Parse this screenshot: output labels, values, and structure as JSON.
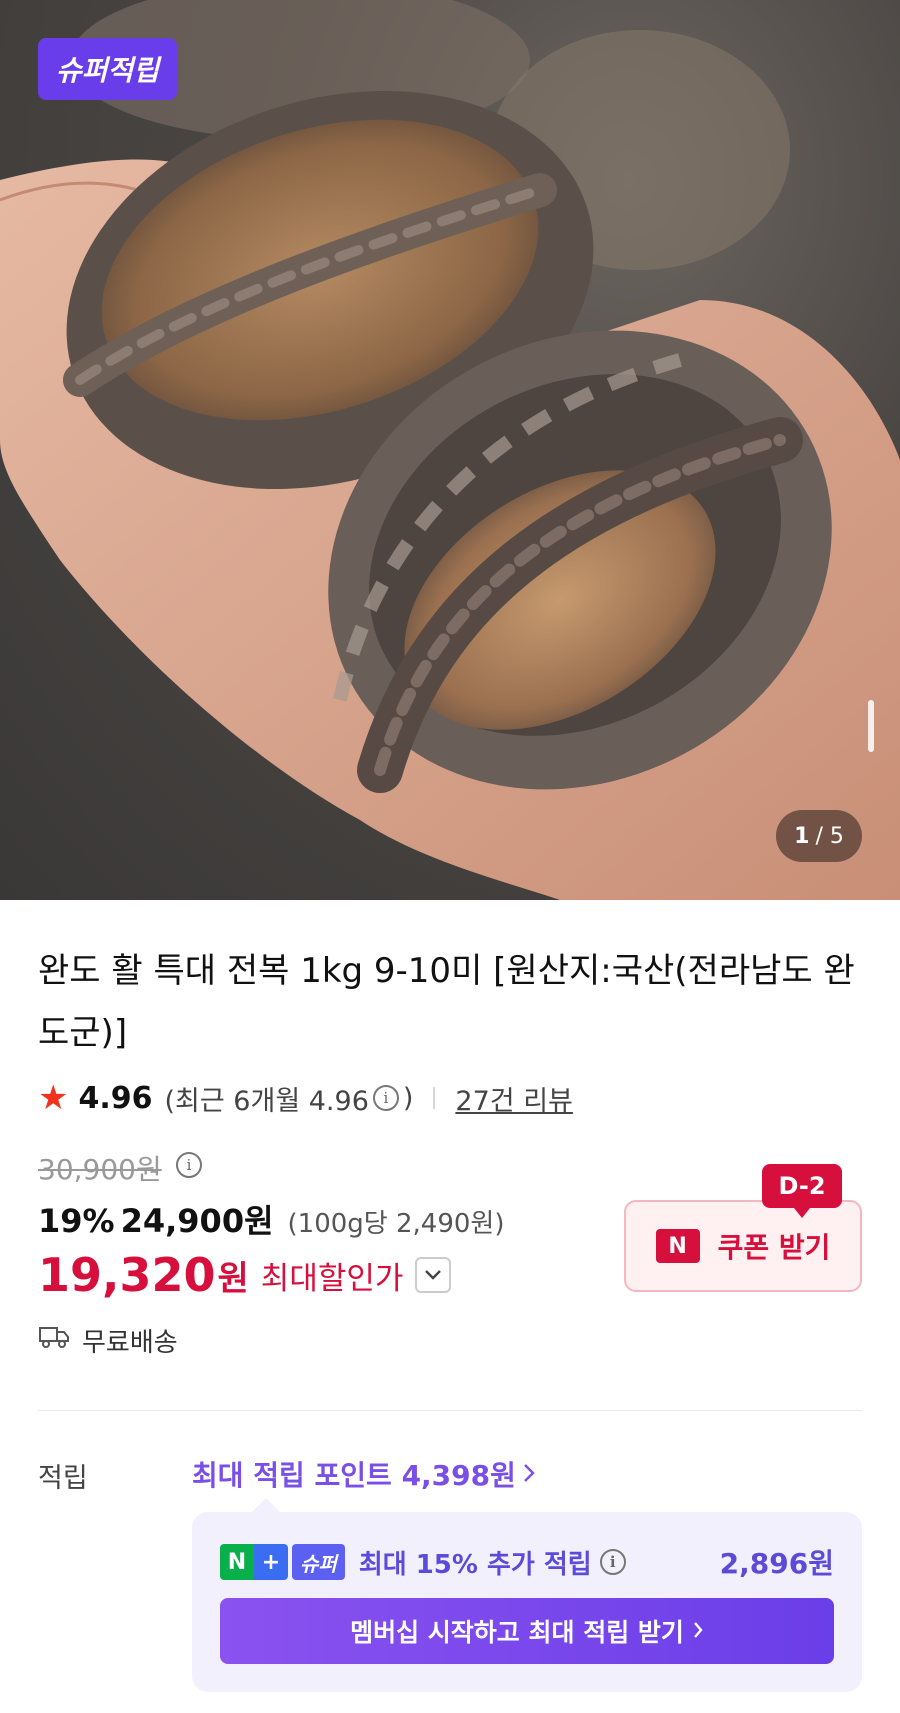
{
  "hero": {
    "badge": "슈퍼적립",
    "image_alt": "abalone",
    "counter_current": "1",
    "counter_total": "/ 5"
  },
  "product": {
    "title": "완도 활 특대 전복 1kg 9-10미 [원산지:국산(전라남도 완도군)]",
    "rating": "4.96",
    "rating_recent": "(최근 6개월 4.96",
    "rating_recent_close": ")",
    "review_count": "27건 리뷰"
  },
  "price": {
    "original": "30,900원",
    "discount_rate": "19%",
    "sale_price": "24,900원",
    "unit_price": "(100g당 2,490원)",
    "max_discount_price": "19,320",
    "max_discount_won": "원",
    "max_discount_label": "최대할인가"
  },
  "coupon": {
    "badge": "D-2",
    "logo": "N",
    "label": "쿠폰 받기"
  },
  "shipping": {
    "label": "무료배송"
  },
  "points": {
    "label": "적립",
    "max_points": "최대 적립 포인트 4,398원",
    "plus_n": "N",
    "plus_p": "+",
    "super_tag": "슈퍼",
    "plus_text": "최대 15% 추가 적립",
    "plus_amount": "2,896원",
    "member_button": "멤버십 시작하고 최대 적립 받기"
  },
  "icons": {
    "star": "star-icon",
    "info": "info-icon",
    "truck": "truck-icon",
    "chevron_right": "chevron-right-icon",
    "chevron_down": "chevron-down-icon"
  },
  "colors": {
    "accent_red": "#d60f3c",
    "accent_purple": "#7a4fe6",
    "star": "#f1331e"
  }
}
